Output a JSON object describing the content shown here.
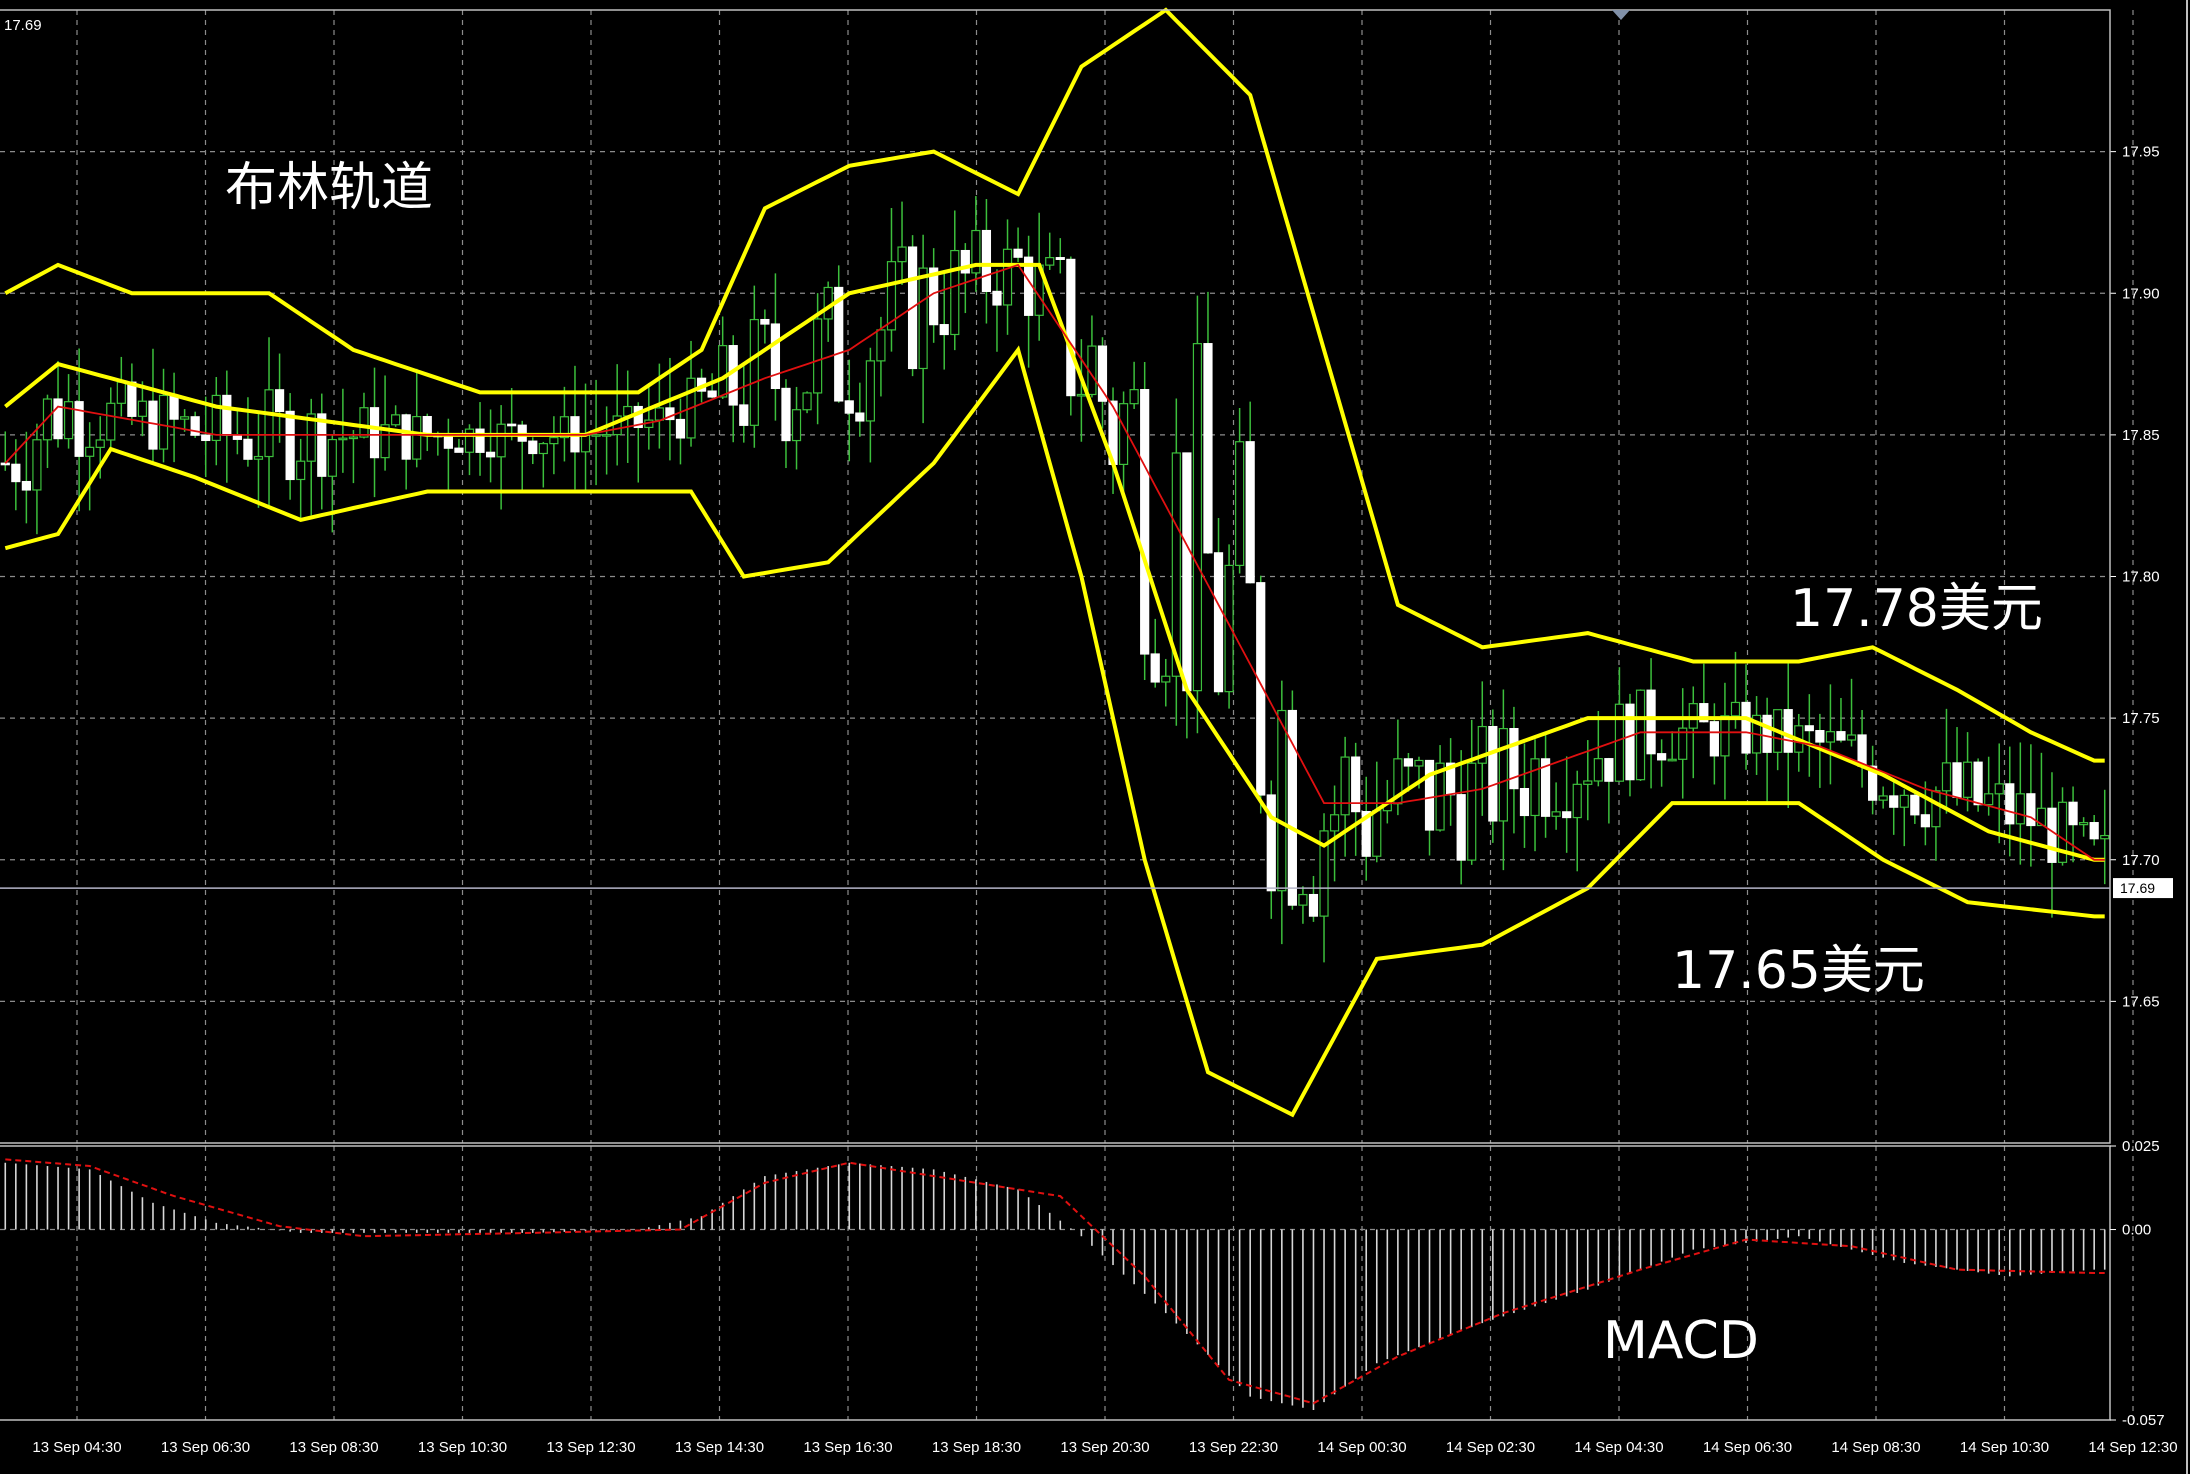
{
  "chart_data": [
    {
      "type": "candlestick",
      "panel": "price",
      "ylim": [
        17.6,
        18.0
      ],
      "yticks": [
        "17.65",
        "17.70",
        "17.75",
        "17.80",
        "17.85",
        "17.90",
        "17.95"
      ],
      "xticks": [
        "13 Sep 04:30",
        "13 Sep 06:30",
        "13 Sep 08:30",
        "13 Sep 10:30",
        "13 Sep 12:30",
        "13 Sep 14:30",
        "13 Sep 16:30",
        "13 Sep 18:30",
        "13 Sep 20:30",
        "13 Sep 22:30",
        "14 Sep 00:30",
        "14 Sep 02:30",
        "14 Sep 04:30",
        "14 Sep 06:30",
        "14 Sep 08:30",
        "14 Sep 10:30",
        "14 Sep 12:30"
      ],
      "corner_label": "17.69",
      "current_price": 17.69,
      "current_price_label": "17.69",
      "grid": true,
      "annotations": {
        "title": "布林轨道",
        "upper_level": "17.78美元",
        "lower_level": "17.65美元"
      },
      "bollinger_mid": [
        [
          0,
          17.86
        ],
        [
          5,
          17.875
        ],
        [
          20,
          17.86
        ],
        [
          40,
          17.85
        ],
        [
          55,
          17.85
        ],
        [
          68,
          17.87
        ],
        [
          80,
          17.9
        ],
        [
          92,
          17.91
        ],
        [
          98,
          17.91
        ],
        [
          105,
          17.84
        ],
        [
          112,
          17.76
        ],
        [
          120,
          17.715
        ],
        [
          125,
          17.705
        ],
        [
          135,
          17.73
        ],
        [
          150,
          17.75
        ],
        [
          165,
          17.75
        ],
        [
          178,
          17.73
        ],
        [
          188,
          17.71
        ],
        [
          198,
          17.7
        ]
      ],
      "bollinger_basis": [
        [
          0,
          17.84
        ],
        [
          5,
          17.86
        ],
        [
          20,
          17.85
        ],
        [
          40,
          17.85
        ],
        [
          55,
          17.85
        ],
        [
          62,
          17.855
        ],
        [
          72,
          17.87
        ],
        [
          80,
          17.88
        ],
        [
          88,
          17.9
        ],
        [
          96,
          17.91
        ],
        [
          105,
          17.86
        ],
        [
          115,
          17.79
        ],
        [
          125,
          17.72
        ],
        [
          132,
          17.72
        ],
        [
          140,
          17.725
        ],
        [
          155,
          17.745
        ],
        [
          165,
          17.745
        ],
        [
          172,
          17.74
        ],
        [
          182,
          17.725
        ],
        [
          192,
          17.715
        ],
        [
          198,
          17.7
        ]
      ],
      "bollinger_upper": [
        [
          0,
          17.9
        ],
        [
          5,
          17.91
        ],
        [
          12,
          17.9
        ],
        [
          25,
          17.9
        ],
        [
          33,
          17.88
        ],
        [
          45,
          17.865
        ],
        [
          60,
          17.865
        ],
        [
          66,
          17.88
        ],
        [
          72,
          17.93
        ],
        [
          80,
          17.945
        ],
        [
          88,
          17.95
        ],
        [
          96,
          17.935
        ],
        [
          102,
          17.98
        ],
        [
          110,
          18.0
        ],
        [
          118,
          17.97
        ],
        [
          125,
          17.88
        ],
        [
          132,
          17.79
        ],
        [
          140,
          17.775
        ],
        [
          150,
          17.78
        ],
        [
          160,
          17.77
        ],
        [
          170,
          17.77
        ],
        [
          177,
          17.775
        ],
        [
          185,
          17.76
        ],
        [
          192,
          17.745
        ],
        [
          198,
          17.735
        ]
      ],
      "bollinger_lower": [
        [
          0,
          17.81
        ],
        [
          5,
          17.815
        ],
        [
          10,
          17.845
        ],
        [
          18,
          17.835
        ],
        [
          28,
          17.82
        ],
        [
          40,
          17.83
        ],
        [
          55,
          17.83
        ],
        [
          65,
          17.83
        ],
        [
          70,
          17.8
        ],
        [
          78,
          17.805
        ],
        [
          88,
          17.84
        ],
        [
          96,
          17.88
        ],
        [
          102,
          17.8
        ],
        [
          108,
          17.7
        ],
        [
          114,
          17.625
        ],
        [
          122,
          17.61
        ],
        [
          130,
          17.665
        ],
        [
          140,
          17.67
        ],
        [
          150,
          17.69
        ],
        [
          158,
          17.72
        ],
        [
          170,
          17.72
        ],
        [
          178,
          17.7
        ],
        [
          186,
          17.685
        ],
        [
          198,
          17.68
        ]
      ]
    },
    {
      "type": "histogram",
      "panel": "MACD",
      "label": "MACD",
      "ylim": [
        -0.057,
        0.025
      ],
      "yticks": [
        "0.025",
        "0.00",
        "-0.057"
      ],
      "histogram": [
        [
          0,
          0.02
        ],
        [
          8,
          0.018
        ],
        [
          14,
          0.008
        ],
        [
          20,
          0.002
        ],
        [
          28,
          -0.001
        ],
        [
          50,
          -0.001
        ],
        [
          60,
          0.0
        ],
        [
          66,
          0.004
        ],
        [
          72,
          0.016
        ],
        [
          80,
          0.02
        ],
        [
          88,
          0.018
        ],
        [
          96,
          0.012
        ],
        [
          102,
          -0.002
        ],
        [
          110,
          -0.025
        ],
        [
          118,
          -0.05
        ],
        [
          124,
          -0.054
        ],
        [
          130,
          -0.04
        ],
        [
          140,
          -0.028
        ],
        [
          150,
          -0.018
        ],
        [
          160,
          -0.006
        ],
        [
          170,
          -0.002
        ],
        [
          180,
          -0.01
        ],
        [
          190,
          -0.014
        ],
        [
          198,
          -0.012
        ]
      ],
      "signal": [
        [
          0,
          0.021
        ],
        [
          8,
          0.019
        ],
        [
          16,
          0.01
        ],
        [
          26,
          0.001
        ],
        [
          34,
          -0.002
        ],
        [
          50,
          -0.001
        ],
        [
          64,
          0.0
        ],
        [
          72,
          0.014
        ],
        [
          80,
          0.02
        ],
        [
          92,
          0.014
        ],
        [
          100,
          0.01
        ],
        [
          108,
          -0.014
        ],
        [
          116,
          -0.045
        ],
        [
          124,
          -0.052
        ],
        [
          132,
          -0.038
        ],
        [
          142,
          -0.025
        ],
        [
          155,
          -0.012
        ],
        [
          165,
          -0.003
        ],
        [
          175,
          -0.005
        ],
        [
          185,
          -0.012
        ],
        [
          198,
          -0.013
        ]
      ]
    }
  ]
}
